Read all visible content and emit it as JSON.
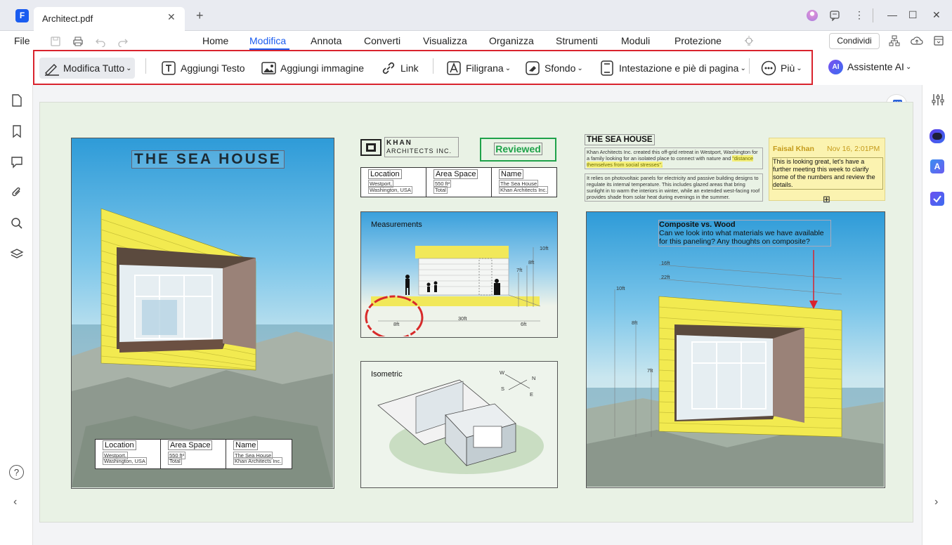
{
  "window": {
    "tab_title": "Architect.pdf",
    "tab_close": "✕",
    "new_tab": "+",
    "minimize": "—",
    "maximize": "☐",
    "close": "✕",
    "kebab": "⋮",
    "share_label": "Condividi"
  },
  "menu": {
    "file": "File",
    "items": [
      "Home",
      "Modifica",
      "Annota",
      "Converti",
      "Visualizza",
      "Organizza",
      "Strumenti",
      "Moduli",
      "Protezione"
    ],
    "active": "Modifica"
  },
  "toolbar": {
    "edit_all": "Modifica Tutto",
    "add_text": "Aggiungi Testo",
    "add_image": "Aggiungi immagine",
    "link": "Link",
    "watermark": "Filigrana",
    "background": "Sfondo",
    "header_footer": "Intestazione e piè di pagina",
    "more": "Più",
    "ai_assistant": "Assistente AI",
    "ai_badge": "AI",
    "dropdown_caret": "⌄",
    "highlight_color": "#d9232d"
  },
  "sidebar_left": {
    "icons": [
      "page-icon",
      "bookmark-icon",
      "comment-icon",
      "attachment-icon",
      "search-icon",
      "layers-icon"
    ],
    "help": "?",
    "collapse": "‹"
  },
  "sidebar_right": {
    "icons": [
      "settings-sliders-icon",
      "ai-robot-icon",
      "translate-icon",
      "task-check-icon"
    ],
    "expand": "›"
  },
  "document": {
    "cover": {
      "title": "THE SEA HOUSE",
      "info": {
        "location_label": "Location",
        "location_value_1": "Westport,",
        "location_value_2": "Washington, USA",
        "area_label": "Area Space",
        "area_value_1": "550 ft²",
        "area_value_2": "Total",
        "name_label": "Name",
        "name_value_1": "The Sea House",
        "name_value_2": "Khan Architects Inc."
      }
    },
    "logo": {
      "line1": "KHAN",
      "line2": "ARCHITECTS INC."
    },
    "stamp": "Reviewed",
    "info_top": {
      "location_label": "Location",
      "location_value_1": "Westport,",
      "location_value_2": "Washington, USA",
      "area_label": "Area Space",
      "area_value_1": "550 ft²",
      "area_value_2": "Total",
      "name_label": "Name",
      "name_value_1": "The Sea House",
      "name_value_2": "Khan Architects Inc."
    },
    "measurements": {
      "title": "Measurements",
      "dims": [
        "10ft",
        "8ft",
        "7ft",
        "8ft",
        "30ft",
        "6ft"
      ]
    },
    "isometric": {
      "title": "Isometric",
      "compass": {
        "w": "W",
        "n": "N",
        "s": "S",
        "e": "E"
      }
    },
    "article": {
      "title": "THE SEA HOUSE",
      "p1_a": "Khan Architects Inc. created this off-grid retreat in Westport, Washington for a family looking for an isolated place to connect with nature and",
      "p1_highlight": "\"distance themselves from social stresses\".",
      "p2": "It relies on photovoltaic panels for electricity and passive building designs to regulate its internal temperature. This includes glazed areas that bring sunlight in to warm the interiors in winter, while an extended west-facing roof provides shade from solar heat during evenings in the summer."
    },
    "sticky_note": {
      "author": "Faisal Khan",
      "date": "Nov 16, 2:01PM",
      "text": "This is looking great, let's have a further meeting this week to clarify some of the numbers and review the details.",
      "expand": "⊞"
    },
    "callout": {
      "title": "Composite vs. Wood",
      "text": "Can we look into what materials we have available for this paneling? Any thoughts on composite?",
      "dims": [
        "16ft",
        "22ft",
        "10ft",
        "8ft",
        "7ft"
      ]
    }
  }
}
